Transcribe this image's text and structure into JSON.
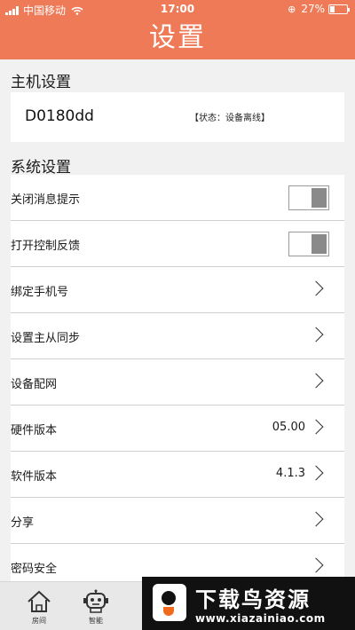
{
  "status_bar": {
    "carrier": "中国移动",
    "time": "17:00",
    "battery": "27%",
    "battery_level": 0.27
  },
  "header": {
    "title": "设置"
  },
  "host_settings": {
    "title": "主机设置",
    "device_id": "D0180dd",
    "status": "【状态：设备离线】"
  },
  "system_settings": {
    "title": "系统设置",
    "items": [
      {
        "label": "关闭消息提示",
        "type": "toggle",
        "on": true
      },
      {
        "label": "打开控制反馈",
        "type": "toggle",
        "on": true
      },
      {
        "label": "绑定手机号",
        "type": "link"
      },
      {
        "label": "设置主从同步",
        "type": "link"
      },
      {
        "label": "设备配网",
        "type": "link"
      },
      {
        "label": "硬件版本",
        "type": "link",
        "value": "05.00"
      },
      {
        "label": "软件版本",
        "type": "link",
        "value": "4.1.3"
      },
      {
        "label": "分享",
        "type": "link"
      },
      {
        "label": "密码安全",
        "type": "link"
      }
    ]
  },
  "tabbar": {
    "items": [
      {
        "label": "房间",
        "icon": "home-icon"
      },
      {
        "label": "智能",
        "icon": "robot-icon"
      }
    ]
  },
  "watermark": {
    "title": "下载鸟资源",
    "url": "www.xiazainiao.com"
  },
  "colors": {
    "accent": "#ee7a57"
  }
}
